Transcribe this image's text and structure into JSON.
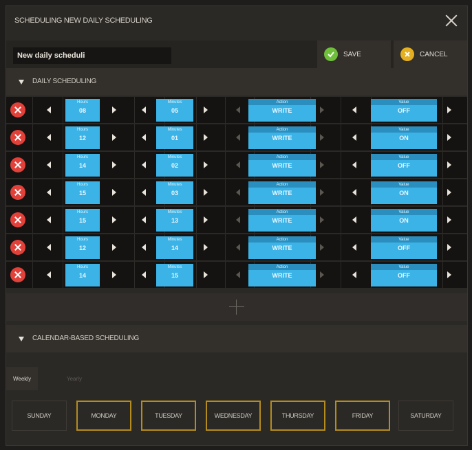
{
  "dialog": {
    "title": "SCHEDULING NEW DAILY SCHEDULING",
    "name_value": "New daily scheduli",
    "save_label": "SAVE",
    "cancel_label": "CANCEL"
  },
  "daily": {
    "header": "DAILY SCHEDULING",
    "captions": {
      "hours": "Hours",
      "minutes": "Minutes",
      "action": "Action",
      "value": "Value"
    },
    "rows": [
      {
        "hours": "08",
        "minutes": "05",
        "action": "WRITE",
        "value": "OFF"
      },
      {
        "hours": "12",
        "minutes": "01",
        "action": "WRITE",
        "value": "ON"
      },
      {
        "hours": "14",
        "minutes": "02",
        "action": "WRITE",
        "value": "OFF"
      },
      {
        "hours": "15",
        "minutes": "03",
        "action": "WRITE",
        "value": "ON"
      },
      {
        "hours": "15",
        "minutes": "13",
        "action": "WRITE",
        "value": "ON"
      },
      {
        "hours": "12",
        "minutes": "14",
        "action": "WRITE",
        "value": "OFF"
      },
      {
        "hours": "14",
        "minutes": "15",
        "action": "WRITE",
        "value": "OFF"
      }
    ]
  },
  "calendar": {
    "header": "CALENDAR-BASED SCHEDULING",
    "tabs": [
      {
        "label": "Weekly",
        "active": true
      },
      {
        "label": "Yearly",
        "active": false
      }
    ],
    "days": [
      {
        "label": "SUNDAY",
        "selected": false
      },
      {
        "label": "MONDAY",
        "selected": true
      },
      {
        "label": "TUESDAY",
        "selected": true
      },
      {
        "label": "WEDNESDAY",
        "selected": true
      },
      {
        "label": "THURSDAY",
        "selected": true
      },
      {
        "label": "FRIDAY",
        "selected": true
      },
      {
        "label": "SATURDAY",
        "selected": false
      }
    ]
  },
  "icons": {
    "close": "close-icon",
    "save": "check-icon",
    "cancel": "cancel-icon",
    "delete": "delete-icon",
    "add": "plus-icon",
    "collapse": "triangle-down-icon"
  },
  "colors": {
    "accent_blue": "#3cb3e6",
    "delete_red": "#e2413a",
    "save_green": "#6fbf3a",
    "cancel_yellow": "#e4b021",
    "selected_day_border": "#b58c1e"
  }
}
